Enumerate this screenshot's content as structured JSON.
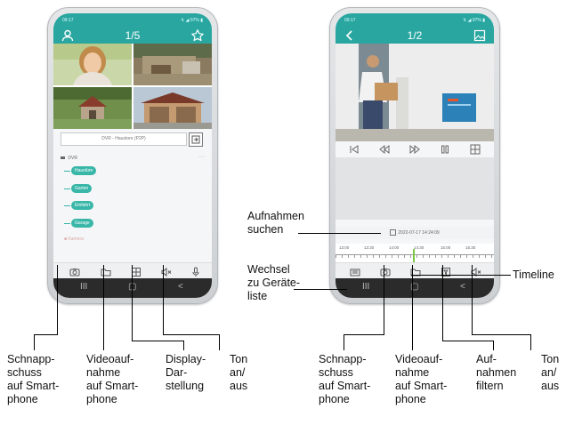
{
  "left_phone": {
    "status_time": "09:17",
    "status_right": "↯ ◢ 97% ▮",
    "title": "1/5",
    "device_bar": "DVR - Haustore (P2P)",
    "tree_header": "DVR",
    "channels": [
      "Haustüre",
      "Garten",
      "Einfahrt",
      "Garage"
    ],
    "channel_faded": "Kamera"
  },
  "right_phone": {
    "status_time": "09:17",
    "status_right": "↯ ◢ 97% ▮",
    "title": "1/2",
    "search_datetime": "2022-07-17 14:24:09",
    "timeline_ticks": [
      "13:00",
      "13:30",
      "14:00",
      "14:30",
      "15:00",
      "15:30"
    ]
  },
  "nav": {
    "recents": "III",
    "home": "▢",
    "back": "<"
  },
  "callouts": {
    "aufnahmen_suchen": "Aufnahmen\nsuchen",
    "wechsel": "Wechsel\nzu Geräte-\nliste",
    "timeline": "Timeline",
    "left": [
      "Schnapp-\nschuss\nauf Smart-\nphone",
      "Videoauf-\nnahme\nauf Smart-\nphone",
      "Display-\nDar-\nstellung",
      "Ton\nan/\naus"
    ],
    "right": [
      "Schnapp-\nschuss\nauf Smart-\nphone",
      "Videoauf-\nnahme\nauf Smart-\nphone",
      "Auf-\nnahmen\nfiltern",
      "Ton\nan/\naus"
    ]
  },
  "colors": {
    "accent": "#2aa6a0",
    "chip": "#38b7a9"
  }
}
